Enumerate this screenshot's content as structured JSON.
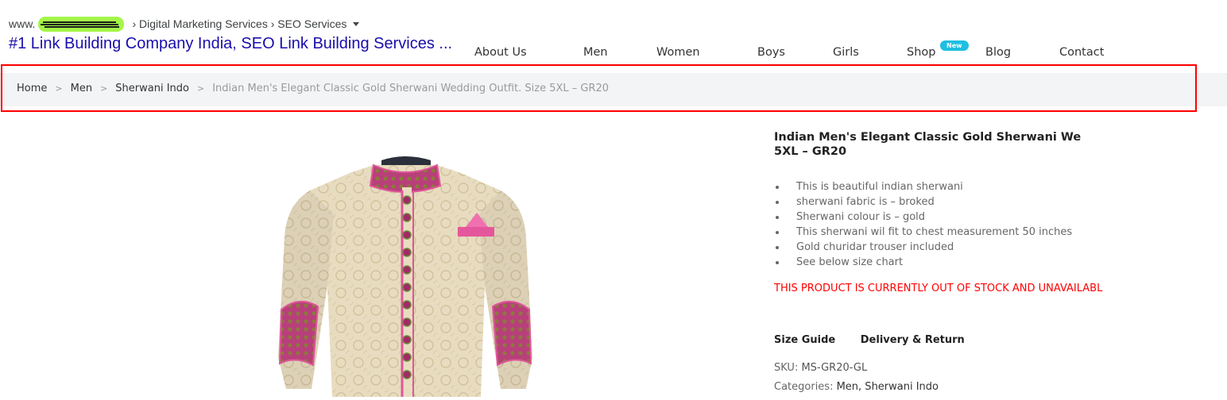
{
  "serp": {
    "url_prefix": "www.",
    "breadcrumb_path": "› Digital Marketing Services › SEO Services",
    "title": "#1 Link Building Company India, SEO Link Building Services ..."
  },
  "nav": {
    "items": [
      "About Us",
      "Men",
      "Women",
      "Boys",
      "Girls",
      "Shop",
      "Blog",
      "Contact"
    ],
    "new_badge": "New"
  },
  "breadcrumb": {
    "home": "Home",
    "men": "Men",
    "category": "Sherwani Indo",
    "current": "Indian Men's Elegant Classic Gold Sherwani Wedding Outfit. Size 5XL – GR20",
    "separator": ">"
  },
  "product": {
    "title_line1": "Indian Men's Elegant Classic Gold Sherwani We",
    "title_line2": "5XL – GR20",
    "features": [
      "This is beautiful indian sherwani",
      "sherwani fabric is – broked",
      "Sherwani colour is – gold",
      "This sherwani wil fit to chest measurement 50 inches",
      "Gold churidar trouser included",
      "See below size chart"
    ],
    "stock_notice": "THIS PRODUCT IS CURRENTLY OUT OF STOCK AND UNAVAILABL",
    "tab_size_guide": "Size Guide",
    "tab_delivery": "Delivery & Return",
    "sku_label": "SKU:",
    "sku_value": "MS-GR20-GL",
    "categories_label": "Categories:",
    "categories_value": "Men, Sherwani Indo"
  },
  "colors": {
    "highlight_box": "#ff0000",
    "serp_title": "#1a0dab",
    "stock_notice": "#ff0000",
    "new_badge": "#1ebfe0",
    "breadcrumb_bg": "#f3f4f6"
  }
}
